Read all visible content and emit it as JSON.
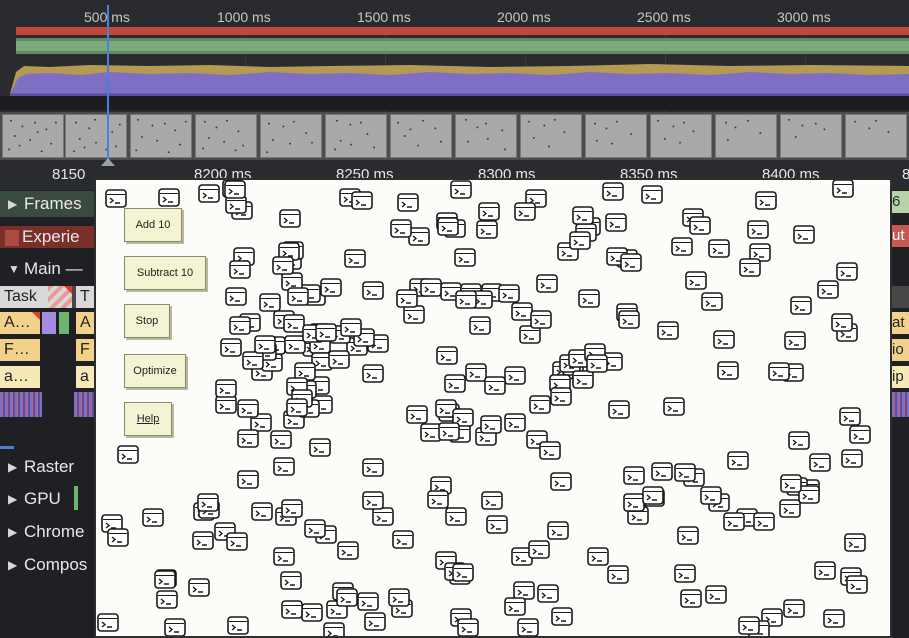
{
  "overview": {
    "ticks": [
      "500 ms",
      "1000 ms",
      "1500 ms",
      "2000 ms",
      "2500 ms",
      "3000 ms"
    ]
  },
  "ruler": {
    "labels": [
      "8150",
      "8200 ms",
      "8250 ms",
      "8300 ms",
      "8350 ms",
      "8400 ms",
      "8"
    ]
  },
  "tracks": {
    "frames": "Frames",
    "experience": "Experie",
    "main": "Main —",
    "raster": "Raster",
    "gpu": "GPU",
    "chrome": "Chrome",
    "compositor": "Compos"
  },
  "main_events": {
    "task": "Task",
    "task_cut": "T",
    "row1": "A…",
    "row1_cut": "A",
    "row2": "F…",
    "row2_cut": "F",
    "row3": "a…",
    "row3_cut": "a"
  },
  "right_edge": {
    "frames": "6",
    "experience": "ut",
    "row1": "at",
    "row2": "io",
    "row3": "ip"
  },
  "app": {
    "buttons": {
      "add": "Add 10",
      "subtract": "Subtract 10",
      "stop": "Stop",
      "optimize": "Optimize",
      "help": "Help"
    }
  },
  "colors": {
    "background": "#1f2023",
    "cpu_purple": "#7e6fc4",
    "cpu_gold": "#b49a52",
    "net_red": "#c3473b",
    "playhead": "#4c7fd9",
    "task_yellow": "#f2d18a"
  }
}
